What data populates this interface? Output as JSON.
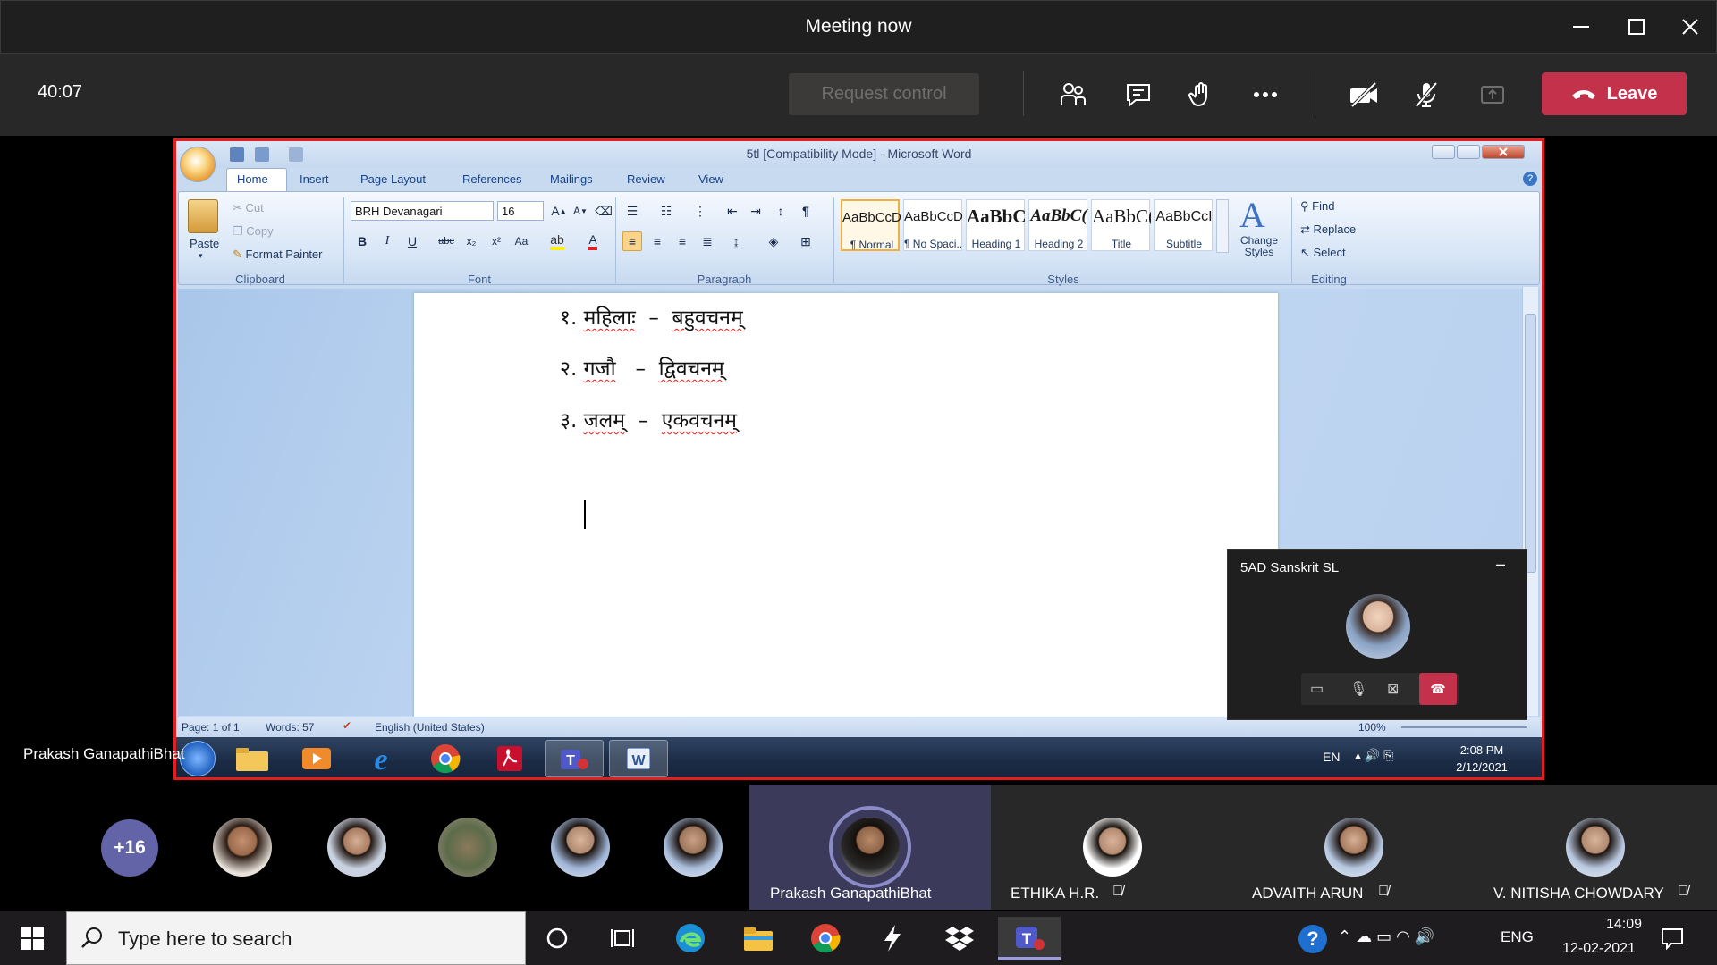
{
  "meeting": {
    "title": "Meeting now",
    "timer": "40:07",
    "request_control": "Request control",
    "leave": "Leave"
  },
  "word": {
    "title": "5tl [Compatibility Mode] - Microsoft Word",
    "tabs": [
      "Home",
      "Insert",
      "Page Layout",
      "References",
      "Mailings",
      "Review",
      "View"
    ],
    "clipboard": {
      "paste": "Paste",
      "cut": "Cut",
      "copy": "Copy",
      "format_painter": "Format Painter",
      "group": "Clipboard"
    },
    "font": {
      "name": "BRH Devanagari",
      "size": "16",
      "group": "Font"
    },
    "paragraph_group": "Paragraph",
    "styles": [
      {
        "sample": "AaBbCcDc",
        "name": "¶ Normal"
      },
      {
        "sample": "AaBbCcDc",
        "name": "¶ No Spaci..."
      },
      {
        "sample": "AaBbC(",
        "name": "Heading 1"
      },
      {
        "sample": "AaBbC(",
        "name": "Heading 2"
      },
      {
        "sample": "AaBbC(",
        "name": "Title"
      },
      {
        "sample": "AaBbCcI",
        "name": "Subtitle"
      }
    ],
    "styles_group": "Styles",
    "change_styles": "Change Styles",
    "editing": {
      "find": "Find",
      "replace": "Replace",
      "select": "Select",
      "group": "Editing"
    },
    "document_lines": [
      {
        "num": "१.",
        "a": "महिलाः",
        "dash": "–",
        "b": "बहुवचनम्"
      },
      {
        "num": "२.",
        "a": "गजौ",
        "dash": "–",
        "b": "द्विवचनम्"
      },
      {
        "num": "३.",
        "a": "जलम्",
        "dash": "–",
        "b": "एकवचनम्"
      }
    ],
    "status": {
      "page": "Page: 1 of 1",
      "words": "Words: 57",
      "language": "English (United States)",
      "zoom": "100%"
    }
  },
  "shared_taskbar": {
    "lang": "EN",
    "time": "2:08 PM",
    "date": "2/12/2021"
  },
  "mini_preview": {
    "title": "5AD Sanskrit SL"
  },
  "presenter_label": "Prakash GanapathiBhat",
  "participants": {
    "overflow": "+16",
    "named": [
      {
        "name": "Prakash GanapathiBhat",
        "muted": false,
        "active": true
      },
      {
        "name": "ETHIKA H.R.",
        "muted": true,
        "active": false
      },
      {
        "name": "ADVAITH ARUN",
        "muted": true,
        "active": false
      },
      {
        "name": "V. NITISHA CHOWDARY",
        "muted": true,
        "active": false
      }
    ]
  },
  "taskbar": {
    "search_placeholder": "Type here to search",
    "lang": "ENG",
    "time": "14:09",
    "date": "12-02-2021"
  },
  "colors": {
    "leave": "#c4314b",
    "share_border": "#e02020",
    "teams_purple": "#6264a7"
  }
}
